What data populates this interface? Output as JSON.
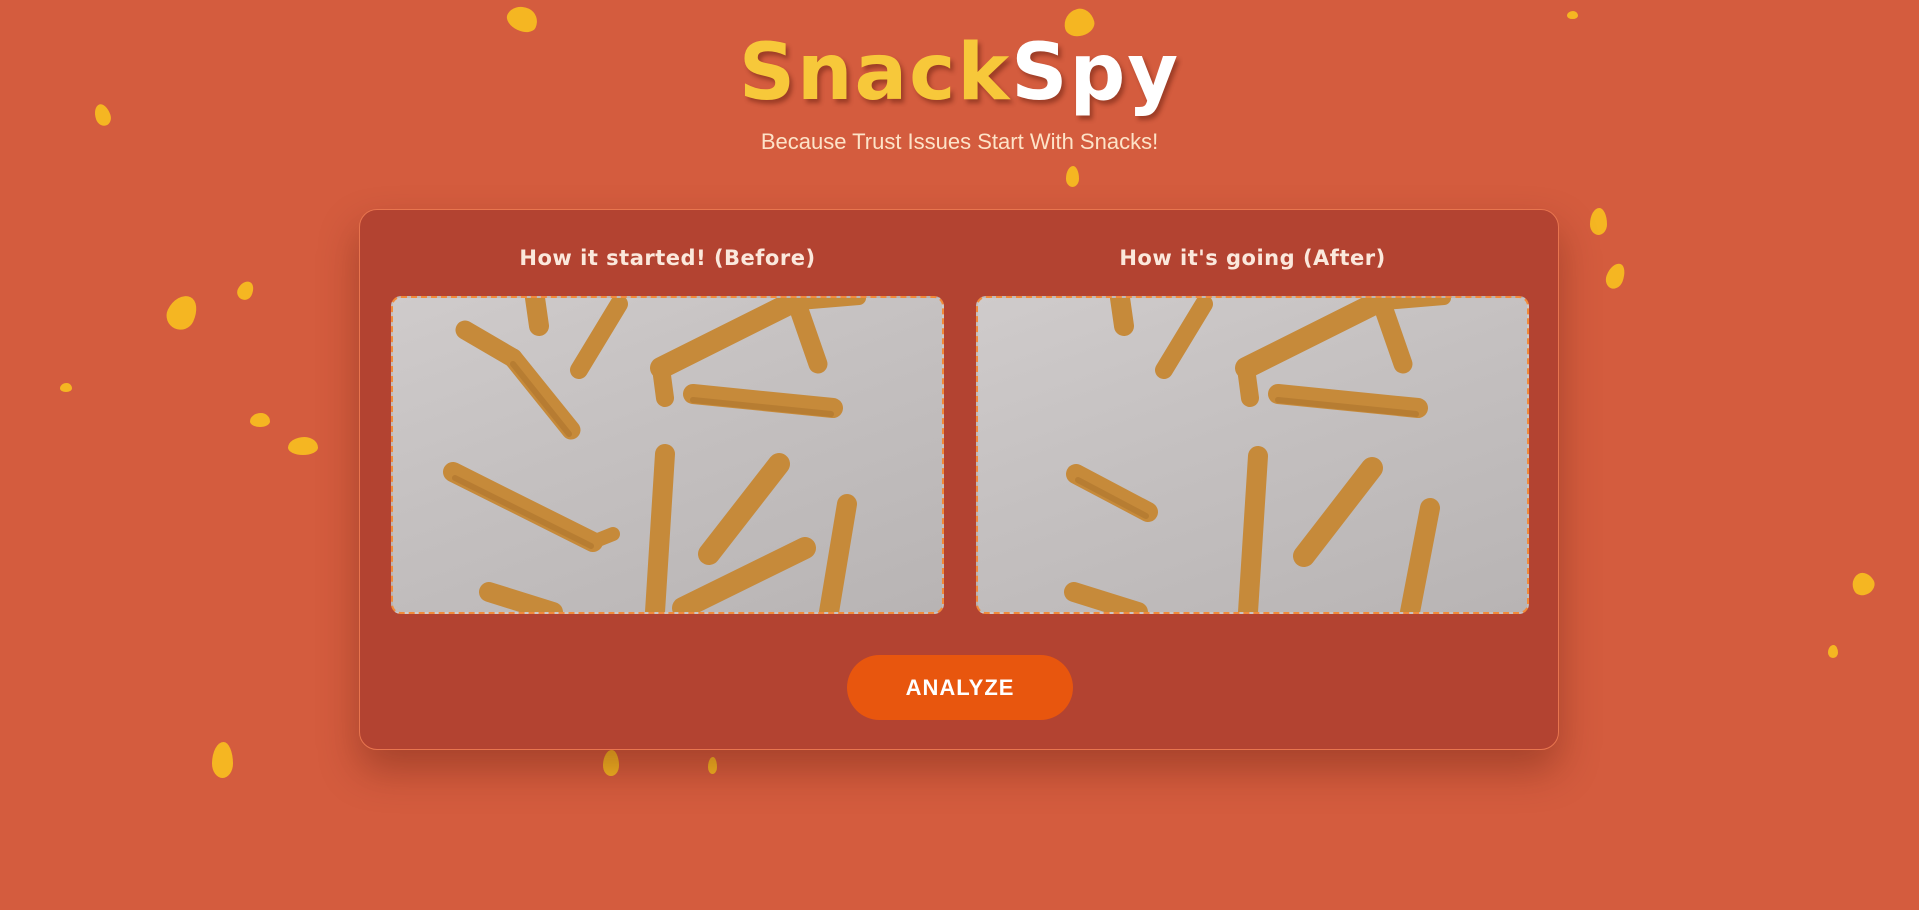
{
  "header": {
    "logo_part1": "Snack",
    "logo_part2": "Spy",
    "tagline": "Because Trust Issues Start With Snacks!"
  },
  "comparison": {
    "before_title": "How it started! (Before)",
    "after_title": "How it's going (After)"
  },
  "actions": {
    "analyze_label": "ANALYZE"
  },
  "colors": {
    "background": "#d45c3e",
    "panel": "#b34331",
    "logo_accent": "#f7c83a",
    "button": "#e8560e",
    "crumbs": "#f5b622",
    "snack": "#c68a3a"
  }
}
